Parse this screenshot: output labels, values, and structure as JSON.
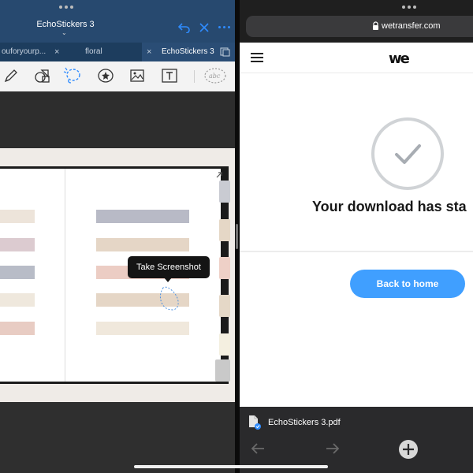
{
  "left_app": {
    "title": "EchoStickers 3",
    "tabs": [
      {
        "label": "ouforyourp...",
        "close": "×"
      },
      {
        "label": "floral",
        "close": "×"
      },
      {
        "label": "EchoStickers 3"
      }
    ],
    "tools": [
      "pen-icon",
      "eraser-icon",
      "shapes-icon",
      "lasso-icon",
      "sticker-icon",
      "image-icon",
      "text-icon",
      "handwriting-text-icon"
    ],
    "tooltip": "Take Screenshot",
    "colors": {
      "header": "#27496f",
      "tabbar": "#1d3d5e",
      "accent": "#2f8cff"
    },
    "left_page_bars": [
      "#ede4da",
      "#dccbd0",
      "#b8bcc7",
      "#efe8dd",
      "#e8ccc3"
    ],
    "right_page_bars": [
      "#b8bac6",
      "#e5d6c6",
      "#eccdc4",
      "#e5d6c6",
      "#f0e8dc"
    ],
    "side_tabs": [
      "#c9cbd2",
      "#e5d7c6",
      "#eed0c7",
      "#e5d8c7",
      "#f4efe0",
      "#c9c9c9"
    ]
  },
  "right_app": {
    "url": "wetransfer.com",
    "logo": "we",
    "heading": "Your download has sta",
    "back_button": "Back to home",
    "download_file": "EchoStickers 3.pdf",
    "colors": {
      "button": "#409fff",
      "check": "#d0d3d6"
    }
  }
}
